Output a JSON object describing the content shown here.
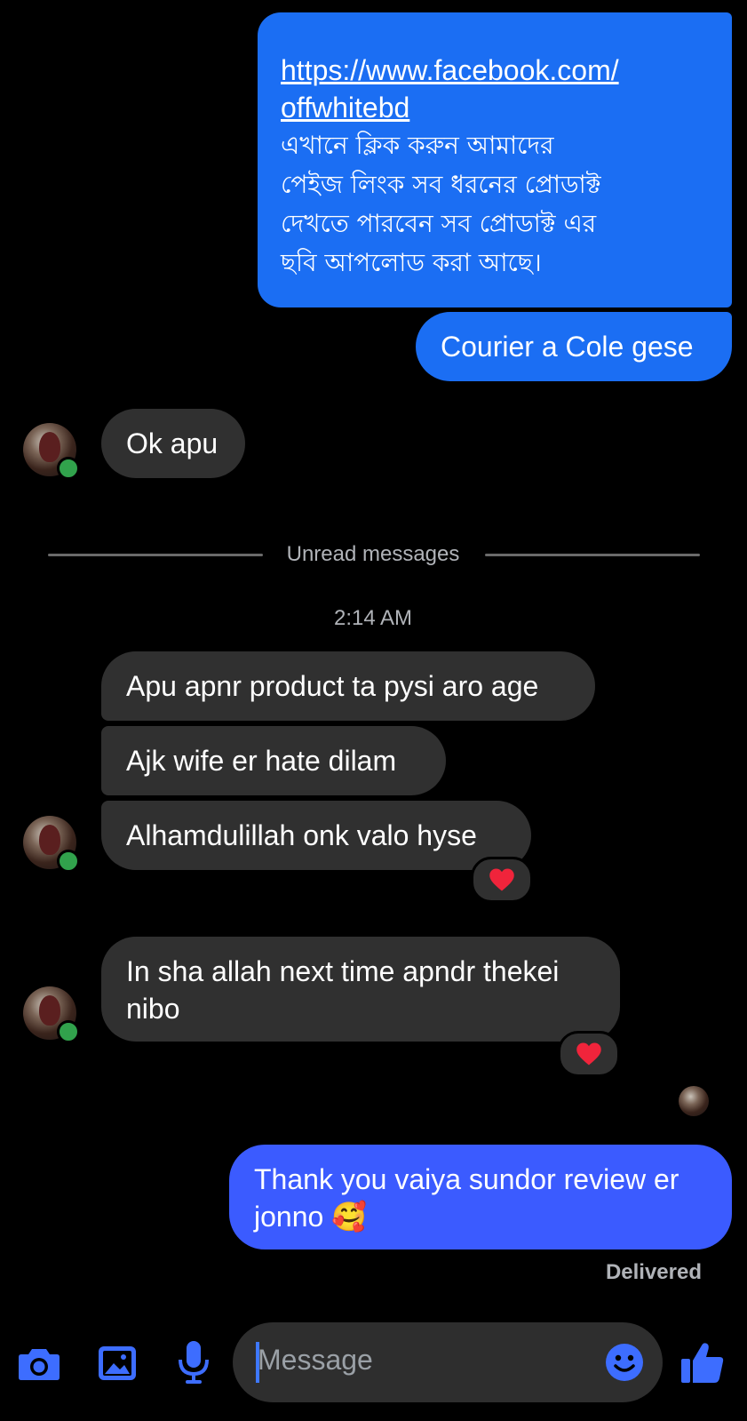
{
  "colors": {
    "outgoing_bubble": "#1b6ef3",
    "outgoing_bubble_last": "#3b5bff",
    "incoming_bubble": "#303030",
    "accent_icons": "#3d6dff",
    "online_dot": "#31a24c",
    "heart": "#f0243b"
  },
  "messages": {
    "out_link_url": "https://www.facebook.com/offwhitebd",
    "out_link_line1": "https://www.facebook.com/",
    "out_link_line2": "offwhitebd",
    "out_bangla_lines": [
      "এখানে ক্লিক করুন আমাদের",
      "পেইজ লিংক সব ধরনের প্রোডাক্ট",
      "দেখতে পারবেন সব প্রোডাক্ট এর",
      "ছবি আপলোড করা আছে।"
    ],
    "out_courier": "Courier a Cole gese",
    "in_ok": "Ok apu",
    "in_group": [
      "Apu apnr product ta pysi aro age",
      "Ajk wife er hate dilam",
      "Alhamdulillah onk valo hyse"
    ],
    "in_inshallah_lines": [
      "In sha allah next time apndr thekei",
      "nibo"
    ],
    "out_thanks_lines": [
      "Thank you vaiya sundor review er",
      "jonno 🥰"
    ]
  },
  "divider": {
    "unread_label": "Unread messages"
  },
  "timestamp": "2:14 AM",
  "status": {
    "delivered": "Delivered"
  },
  "composer": {
    "placeholder": "Message",
    "icons": [
      "camera-icon",
      "gallery-icon",
      "microphone-icon",
      "emoji-icon",
      "thumbs-up-icon"
    ]
  }
}
